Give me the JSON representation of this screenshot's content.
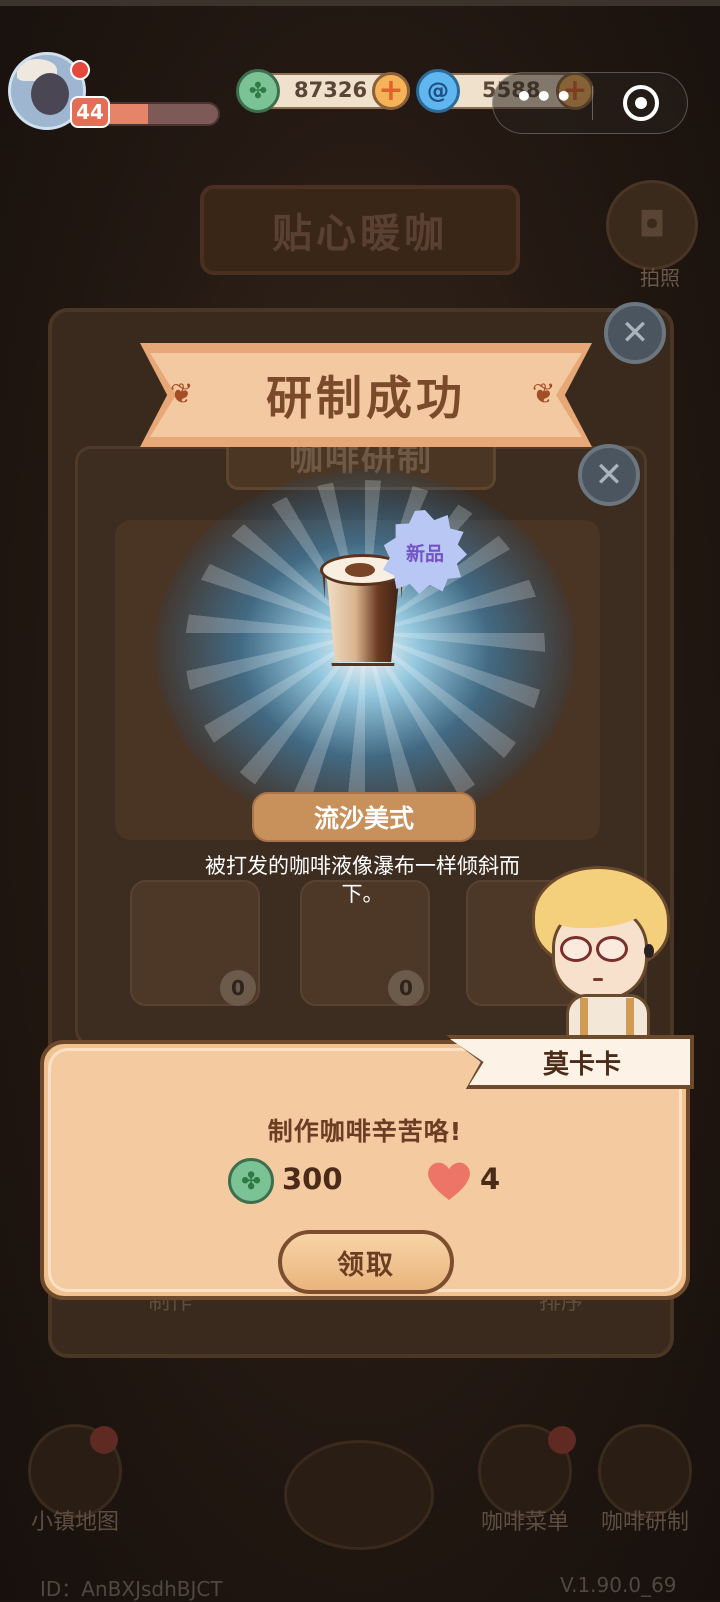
{
  "hud": {
    "level": "44",
    "level_progress": 0.45,
    "currency_green": {
      "icon": "clover-coin-icon",
      "value": "87326"
    },
    "currency_blue": {
      "icon": "swirl-gem-icon",
      "value": "5588"
    },
    "capsule_more": "•••"
  },
  "background": {
    "shop_title": "贴心暖咖",
    "camera_label": "拍照",
    "left_btn_label": "制作",
    "right_btn_label": "排序",
    "nav": {
      "map_label": "小镇地图",
      "menu_label": "咖啡菜单",
      "research_label": "咖啡研制"
    },
    "footer_id": "ID：AnBXJsdhBJCT",
    "footer_version": "V.1.90.0_69"
  },
  "research_panel": {
    "title": "咖啡研制",
    "ingredient_counts": [
      "0",
      "0"
    ]
  },
  "success": {
    "banner_title": "研制成功",
    "new_badge": "新品",
    "item_name": "流沙美式",
    "item_desc": "被打发的咖啡液像瀑布一样倾斜而下。"
  },
  "reward_dialog": {
    "speaker": "莫卡卡",
    "message": "制作咖啡辛苦咯!",
    "rewards": [
      {
        "icon": "clover-coin-icon",
        "value": "300"
      },
      {
        "icon": "heart-icon",
        "value": "4"
      }
    ],
    "claim_label": "领取"
  },
  "colors": {
    "panel_bg": "#f4caa0",
    "banner": "#f3c9a1",
    "accent_orange": "#e6846a",
    "glow_blue": "#6fc6f0"
  }
}
